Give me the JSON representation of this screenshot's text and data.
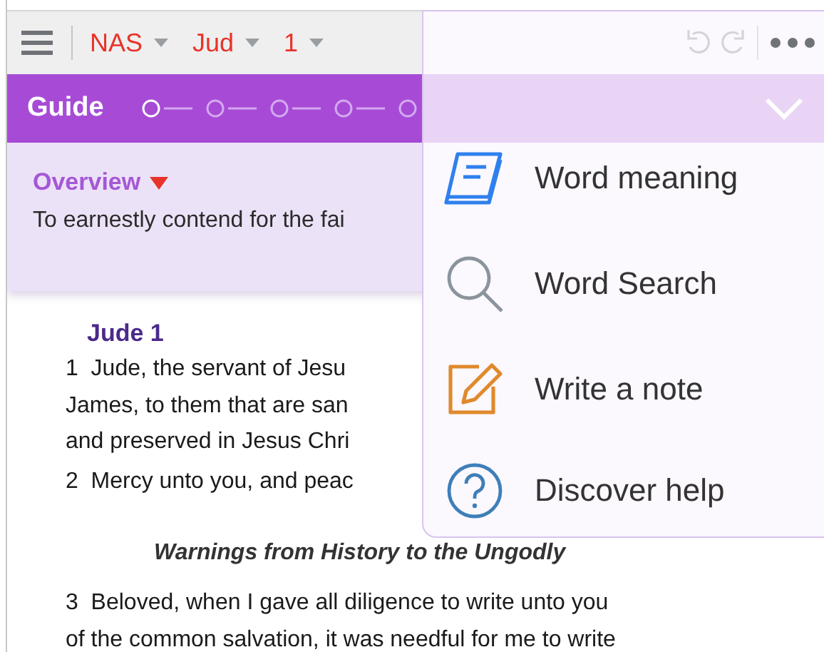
{
  "toolbar": {
    "selectors": [
      {
        "label": "NAS"
      },
      {
        "label": "Jud"
      },
      {
        "label": "1"
      }
    ]
  },
  "guide": {
    "title": "Guide"
  },
  "overview": {
    "title": "Overview",
    "text": "To earnestly contend for the fai"
  },
  "passage": {
    "heading": "Jude 1",
    "blocks": [
      {
        "kind": "verse",
        "lines": [
          "1  Jude, the servant of Jesu",
          "James, to them that are san",
          "and preserved in Jesus Chri"
        ]
      },
      {
        "kind": "verse",
        "lines": [
          "2  Mercy unto you, and peac"
        ]
      },
      {
        "kind": "section",
        "text": "Warnings from History to the Ungodly"
      },
      {
        "kind": "verse",
        "lines": [
          "3  Beloved, when I gave all diligence to write unto you",
          "of the common salvation, it was needful for me to write"
        ]
      }
    ]
  },
  "menu": {
    "items": [
      {
        "kind": "meaning",
        "label": "Word meaning"
      },
      {
        "kind": "search",
        "label": "Word Search"
      },
      {
        "kind": "note",
        "label": "Write a note"
      },
      {
        "kind": "help",
        "label": "Discover help"
      }
    ]
  }
}
